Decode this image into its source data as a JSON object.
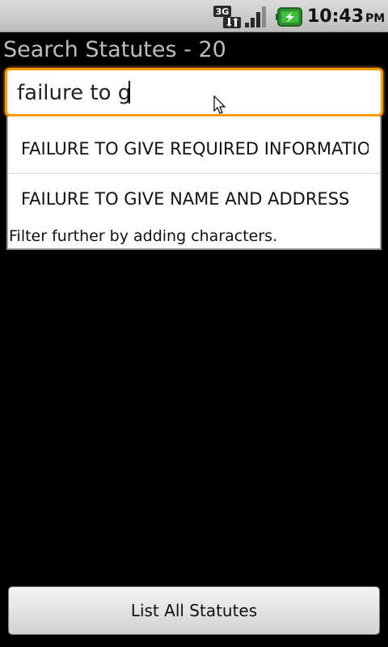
{
  "status_bar": {
    "network_icon": "3g-data-icon",
    "signal_icon": "signal-strength-icon",
    "battery_icon": "battery-charging-icon",
    "time": "10:43",
    "ampm": "PM",
    "colors": {
      "bar": "#c8c8c8",
      "battery": "#2f8f2f"
    }
  },
  "header": {
    "title": "Search Statutes - 20"
  },
  "search": {
    "value": "failure to g",
    "focus_color": "#ff9a00",
    "pointer_icon": "mouse-pointer-icon"
  },
  "suggestions": {
    "items": [
      "FAILURE TO GIVE REQUIRED INFORMATION",
      "FAILURE TO GIVE NAME AND ADDRESS"
    ],
    "hint": "Filter further by adding characters."
  },
  "footer": {
    "button_label": "List All Statutes"
  }
}
